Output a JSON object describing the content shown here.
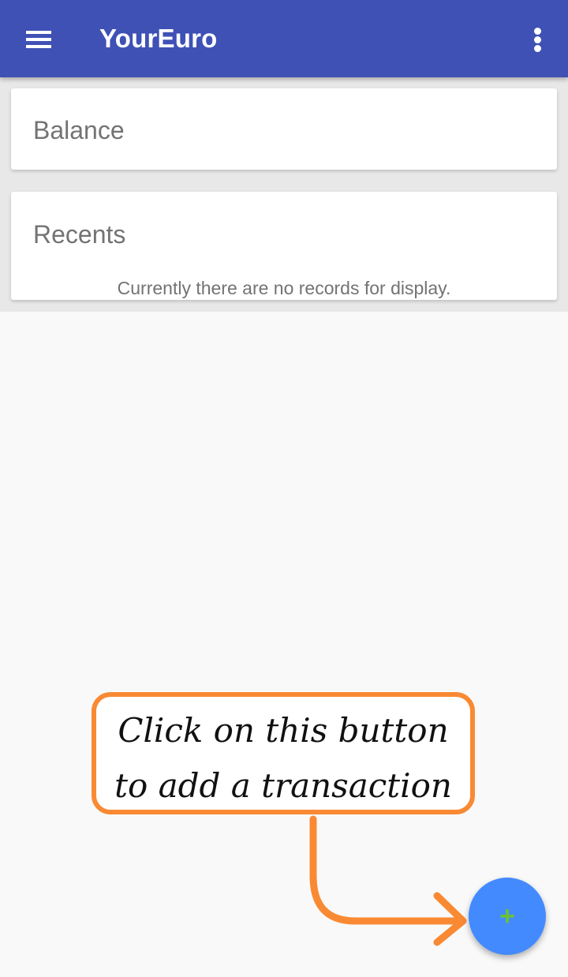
{
  "app_bar": {
    "title": "YourEuro",
    "menu_icon": "hamburger-menu-icon",
    "overflow_icon": "more-vert-icon",
    "color": "#3f51b5"
  },
  "balance_card": {
    "title": "Balance"
  },
  "recents_card": {
    "title": "Recents",
    "empty_message": "Currently there are no records for display."
  },
  "tutorial_callout": {
    "line1": "Click on this button",
    "line2": "to add a transaction",
    "border_color": "#f98a33"
  },
  "fab": {
    "icon": "plus-icon",
    "symbol": "+",
    "color": "#448aff"
  }
}
